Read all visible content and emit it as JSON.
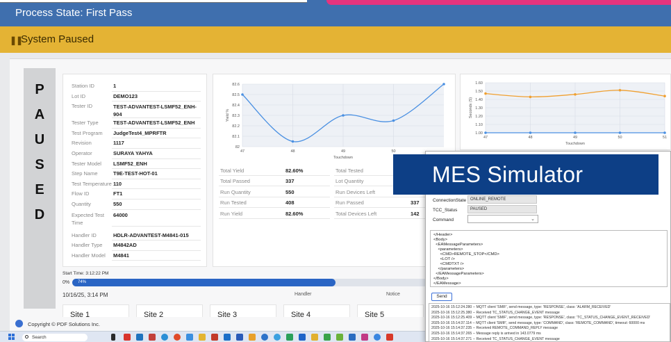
{
  "header": {
    "title": "Process State: First Pass"
  },
  "status": {
    "icon": "pause-icon",
    "text": "System Paused",
    "color": "#e4b334"
  },
  "pause_letters": [
    "P",
    "A",
    "U",
    "S",
    "E",
    "D"
  ],
  "station_info": [
    {
      "label": "Station ID",
      "value": "1"
    },
    {
      "label": "Lot ID",
      "value": "DEMO123"
    },
    {
      "label": "Tester ID",
      "value": "TEST-ADVANTEST-LSMF52_ENH-904"
    },
    {
      "label": "Tester Type",
      "value": "TEST-ADVANTEST-LSMF52_ENH"
    },
    {
      "label": "Test Program",
      "value": "JudgeTest4_MPRFTR"
    },
    {
      "label": "Revision",
      "value": "1117"
    },
    {
      "label": "Operator",
      "value": "SURAYA YAHYA"
    },
    {
      "label": "Tester Model",
      "value": "LSMF52_ENH"
    },
    {
      "label": "Step Name",
      "value": "T9E-TEST-HOT-01"
    },
    {
      "label": "Test Temperature",
      "value": "110"
    },
    {
      "label": "Flow ID",
      "value": "FT1"
    },
    {
      "label": "Quantity",
      "value": "550"
    },
    {
      "label": "Expected Test Time",
      "value": "64000"
    },
    {
      "label": "Handler ID",
      "value": "HDLR-ADVANTEST-M4841-015"
    },
    {
      "label": "Handler Type",
      "value": "M4842AD"
    },
    {
      "label": "Handler Model",
      "value": "M4841"
    }
  ],
  "yield_chart": {
    "ylabel": "Yield %",
    "xlabel": "Touchdown",
    "yticks": [
      "82.6",
      "82.5",
      "82.4",
      "82.3",
      "82.2",
      "82.1",
      "82"
    ],
    "xticks": [
      "47",
      "48",
      "49",
      "50"
    ]
  },
  "time_chart": {
    "ylabel": "Seconds (S)",
    "xlabel": "Touchdown",
    "yticks": [
      "1.60",
      "1.50",
      "1.40",
      "1.30",
      "1.20",
      "1.10",
      "1.00"
    ],
    "xticks": [
      "47",
      "48",
      "49",
      "50",
      "51"
    ]
  },
  "chart_data": [
    {
      "type": "line",
      "title": "",
      "xlabel": "Touchdown",
      "ylabel": "Yield %",
      "x": [
        47,
        48,
        49,
        50,
        51
      ],
      "series": [
        {
          "values": [
            82.5,
            82.05,
            82.3,
            82.25,
            82.6
          ],
          "color": "#4a90e2"
        }
      ],
      "ylim": [
        82,
        82.6
      ],
      "grid": true
    },
    {
      "type": "line",
      "title": "",
      "xlabel": "Touchdown",
      "ylabel": "Seconds (S)",
      "x": [
        47,
        48,
        49,
        50,
        51
      ],
      "series": [
        {
          "values": [
            1.47,
            1.43,
            1.46,
            1.51,
            1.44
          ],
          "color": "#f0a030"
        },
        {
          "values": [
            1.0,
            1.0,
            1.0,
            1.0,
            1.0
          ],
          "color": "#4a90e2"
        }
      ],
      "ylim": [
        1.0,
        1.6
      ],
      "grid": true
    }
  ],
  "stats": {
    "left": [
      {
        "label": "Total Yield",
        "value": "82.60%"
      },
      {
        "label": "Total Passed",
        "value": "337"
      },
      {
        "label": "Run Quantity",
        "value": "550"
      },
      {
        "label": "Run Tested",
        "value": "408"
      },
      {
        "label": "Run Yield",
        "value": "82.60%"
      }
    ],
    "right": [
      {
        "label": "Total Tested",
        "value": ""
      },
      {
        "label": "Lot Quantity",
        "value": ""
      },
      {
        "label": "Run Devices Left",
        "value": ""
      },
      {
        "label": "Run Passed",
        "value": "337"
      },
      {
        "label": "Total Devices Left",
        "value": "142"
      }
    ]
  },
  "progress": {
    "start_time": "Start Time: 3:12:22 PM",
    "left_label": "0%",
    "pill_label": "74%",
    "fraction": 0.74
  },
  "info_row": {
    "date": "10/16/25, 3:14 PM",
    "handler": "Handler",
    "notice": "Notice"
  },
  "sites": [
    "Site 1",
    "Site 2",
    "Site 3",
    "Site 4",
    "Site 5"
  ],
  "footer": {
    "text": "Copyright © PDF Solutions Inc."
  },
  "taskbar": {
    "search_placeholder": "Search"
  },
  "mes": {
    "banner": "MES Simulator",
    "connection_label": "ConnectionState",
    "connection_value": "ONLINE_REMOTE",
    "tcc_label": "TCC_Status",
    "tcc_value": "PAUSED",
    "command_label": "Command",
    "xml_lines": [
      "</Header>",
      "<Body>",
      "  <EAMessageParameters>",
      "    <parameters>",
      "      <CMD>REMOTE_STOP</CMD>",
      "      <LOT />",
      "      <CMDTXT />",
      "    </parameters>",
      "  </EAMessageParameters>",
      "</Body>",
      "</EAMessage>"
    ],
    "send_label": "Send",
    "log_lines": [
      "2025-10-16 15:12:24.280 -- MQTT client 'SMIF', send message, type: 'RESPONSE', class: 'ALARM_RECEIVED'",
      "2025-10-16 15:12:25.380 -- Received TC_STATUS_CHANGE_EVENT message",
      "2025-10-16 15:12:25.409 -- MQTT client 'SMIF', send message, type: 'RESPONSE', class: 'TC_STATUS_CHANGE_EVENT_RECEIVED'",
      "2025-10-16 15:14:37.114 -- MQTT client 'SMIF', send message, type: 'COMMAND', class: 'REMOTE_COMMAND', timeout: 60000 ms",
      "2025-10-16 15:14:37.235 -- Received REMOTE_COMMAND_REPLY message",
      "2025-10-16 15:14:37.265 -- Message reply is arrived in 143.0779 ms",
      "2025-10-16 15:14:37.271 -- Received TC_STATUS_CHANGE_EVENT message"
    ]
  }
}
